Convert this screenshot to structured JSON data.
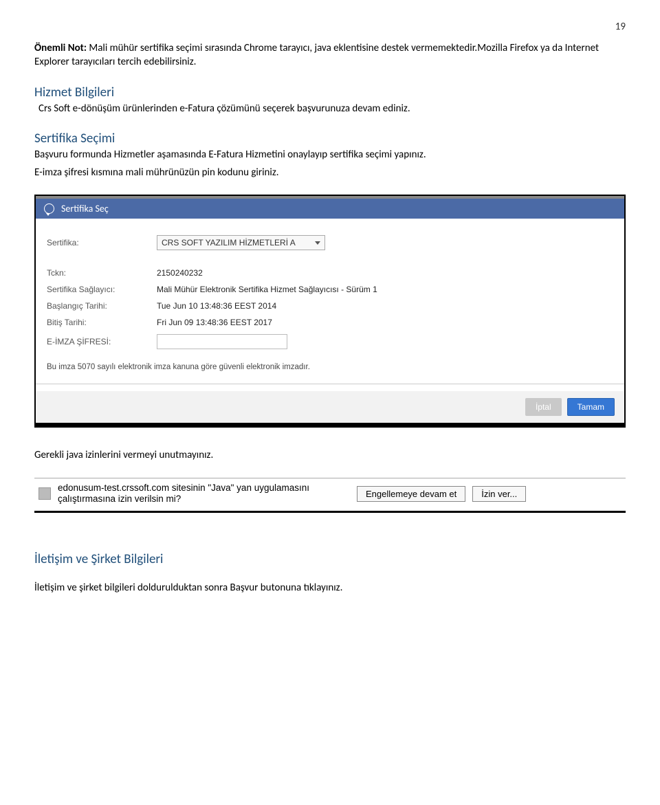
{
  "page_number": "19",
  "note": {
    "bold": "Önemli Not:",
    "rest": " Mali mühür sertifika seçimi sırasında Chrome tarayıcı, java eklentisine destek vermemektedir.Mozilla Firefox ya da Internet Explorer tarayıcıları tercih edebilirsiniz."
  },
  "section1": {
    "heading": "Hizmet Bilgileri",
    "text": " Crs Soft e-dönüşüm ürünlerinden e-Fatura çözümünü seçerek başvurunuza devam ediniz."
  },
  "section2": {
    "heading": "Sertifika Seçimi",
    "line1": "Başvuru formunda Hizmetler aşamasında E-Fatura Hizmetini onaylayıp sertifika seçimi yapınız.",
    "line2": "E-imza şifresi kısmına mali mührünüzün pin kodunu giriniz."
  },
  "modal": {
    "title": "Sertifika Seç",
    "fields": {
      "sertifika_label": "Sertifika:",
      "sertifika_value": "CRS SOFT YAZILIM HİZMETLERİ A",
      "tckn_label": "Tckn:",
      "tckn_value": "2150240232",
      "saglayici_label": "Sertifika Sağlayıcı:",
      "saglayici_value": "Mali Mühür Elektronik Sertifika Hizmet Sağlayıcısı - Sürüm 1",
      "baslangic_label": "Başlangıç Tarihi:",
      "baslangic_value": "Tue Jun 10 13:48:36 EEST 2014",
      "bitis_label": "Bitiş Tarihi:",
      "bitis_value": "Fri Jun 09 13:48:36 EEST 2017",
      "sifre_label": "E-İMZA ŞİFRESİ:",
      "sifre_value": ""
    },
    "disclaimer": "Bu imza 5070 sayılı elektronik imza kanuna göre güvenli elektronik imzadır.",
    "cancel": "İptal",
    "ok": "Tamam"
  },
  "java_line": "Gerekli java izinlerini vermeyi unutmayınız.",
  "java_prompt": {
    "text": "edonusum-test.crssoft.com sitesinin \"Java\" yan uygulamasını çalıştırmasına izin verilsin mi?",
    "block": "Engellemeye devam et",
    "allow": "İzin ver..."
  },
  "section3": {
    "heading": "İletişim ve Şirket Bilgileri",
    "text": "İletişim ve şirket bilgileri doldurulduktan sonra Başvur butonuna tıklayınız."
  }
}
